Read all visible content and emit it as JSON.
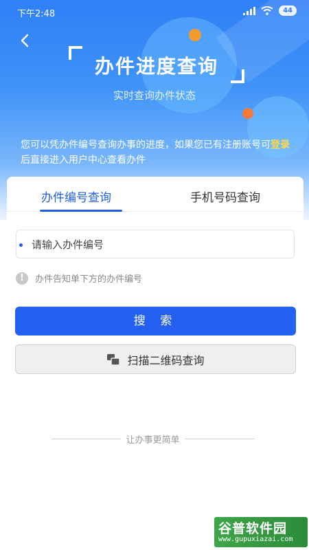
{
  "status_bar": {
    "time": "下午2:48",
    "signal": "signal-icon",
    "wifi": "wifi-icon",
    "battery": "44"
  },
  "header": {
    "back_icon": "back-arrow-icon",
    "title": "办件进度查询",
    "subtitle": "实时查询办件状态"
  },
  "intro": {
    "text_before": "您可以凭办件编号查询办事的进度，如果您已有注册账号可",
    "link": "登录",
    "text_after": "后直接进入用户中心查看办件"
  },
  "tabs": [
    {
      "label": "办件编号查询",
      "active": true
    },
    {
      "label": "手机号码查询",
      "active": false
    }
  ],
  "form": {
    "placeholder": "请输入办件编号",
    "hint": "办件告知单下方的办件编号",
    "search_label": "搜 索",
    "scan_label": "扫描二维码查询"
  },
  "footer": {
    "slogan": "让办事更简单"
  },
  "watermark": {
    "title": "谷普软件园",
    "url": "www.gupuxiazai.com"
  },
  "colors": {
    "primary": "#2461f2",
    "header_blue": "#2f7ff6",
    "link_yellow": "#ffd84a",
    "accent_orange": "#f39c2b"
  }
}
